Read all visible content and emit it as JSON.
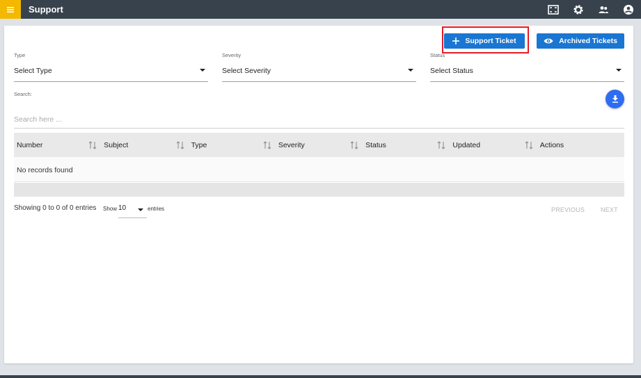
{
  "header": {
    "title": "Support",
    "icons": [
      "menu-icon",
      "fullscreen-icon",
      "settings-icon",
      "users-icon",
      "account-icon"
    ]
  },
  "actions": {
    "support_ticket_label": "Support Ticket",
    "archived_tickets_label": "Archived Tickets"
  },
  "filters": [
    {
      "label": "Type",
      "value": "Select Type"
    },
    {
      "label": "Severity",
      "value": "Select Severity"
    },
    {
      "label": "Status",
      "value": "Select Status"
    }
  ],
  "search": {
    "label": "Search:",
    "placeholder": "Search here ..."
  },
  "table": {
    "columns": [
      "Number",
      "Subject",
      "Type",
      "Severity",
      "Status",
      "Updated",
      "Actions"
    ],
    "empty_message": "No records found"
  },
  "footer": {
    "showing_text": "Showing 0 to 0 of 0 entries",
    "show_label": "Show",
    "page_size": "10",
    "entries_label": "entries",
    "previous_label": "PREVIOUS",
    "next_label": "NEXT"
  },
  "colors": {
    "topbar": "#37424d",
    "menu_accent": "#f5b800",
    "primary": "#1976d2",
    "download": "#2e6cf2",
    "highlight": "#e31b23"
  }
}
